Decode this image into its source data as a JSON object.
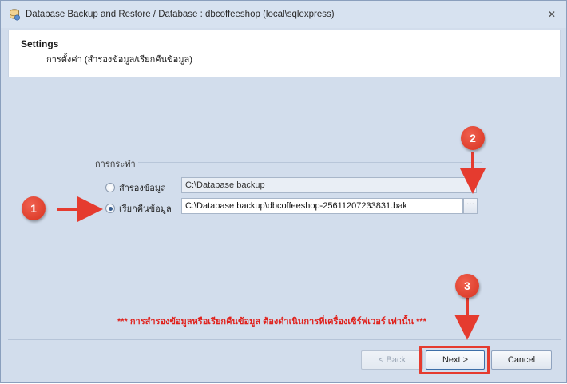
{
  "window": {
    "title": "Database Backup and Restore / Database : dbcoffeeshop (local\\sqlexpress)",
    "close_glyph": "✕"
  },
  "header": {
    "title": "Settings",
    "subtitle": "การตั้งค่า (สำรองข้อมูล/เรียกคืนข้อมูล)"
  },
  "action_group": {
    "label": "การกระทำ",
    "backup": {
      "label": "สำรองข้อมูล",
      "checked": false,
      "path": "C:\\Database backup"
    },
    "restore": {
      "label": "เรียกคืนข้อมูล",
      "checked": true,
      "path": "C:\\Database backup\\dbcoffeeshop-25611207233831.bak",
      "browse_label": "···"
    }
  },
  "warning": "*** การสำรองข้อมูลหรือเรียกคืนข้อมูล ต้องดำเนินการที่เครื่องเซิร์ฟเวอร์ เท่านั้น ***",
  "footer": {
    "back_label": "< Back",
    "next_label": "Next >",
    "cancel_label": "Cancel"
  },
  "annotations": {
    "badges": [
      "1",
      "2",
      "3"
    ],
    "color": "#e53b2f"
  },
  "icons": {
    "app": "database-backup-icon",
    "close": "close-icon"
  }
}
